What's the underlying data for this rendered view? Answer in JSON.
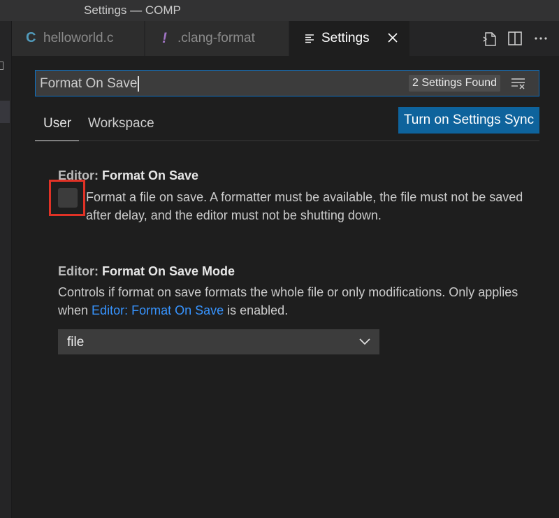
{
  "window": {
    "title": "Settings — COMP"
  },
  "tabs": [
    {
      "icon": "C",
      "label": "helloworld.c"
    },
    {
      "icon": "!",
      "label": ".clang-format"
    },
    {
      "label": "Settings",
      "close": "✕"
    }
  ],
  "search": {
    "value": "Format On Save",
    "results": "2 Settings Found"
  },
  "scopes": {
    "user": "User",
    "workspace": "Workspace"
  },
  "sync_button": "Turn on Settings Sync",
  "settings": [
    {
      "category": "Editor: ",
      "name": "Format On Save",
      "description": "Format a file on save. A formatter must be available, the file must not be saved after delay, and the editor must not be shutting down.",
      "checked": false
    },
    {
      "category": "Editor: ",
      "name": "Format On Save Mode",
      "description_before": "Controls if format on save formats the whole file or only modifications. Only applies when ",
      "description_link": "Editor: Format On Save",
      "description_after": " is enabled.",
      "value": "file"
    }
  ],
  "colors": {
    "accent": "#0e639c",
    "focus_border": "#0e70c0",
    "highlight": "#e03226",
    "link": "#3794ff"
  }
}
